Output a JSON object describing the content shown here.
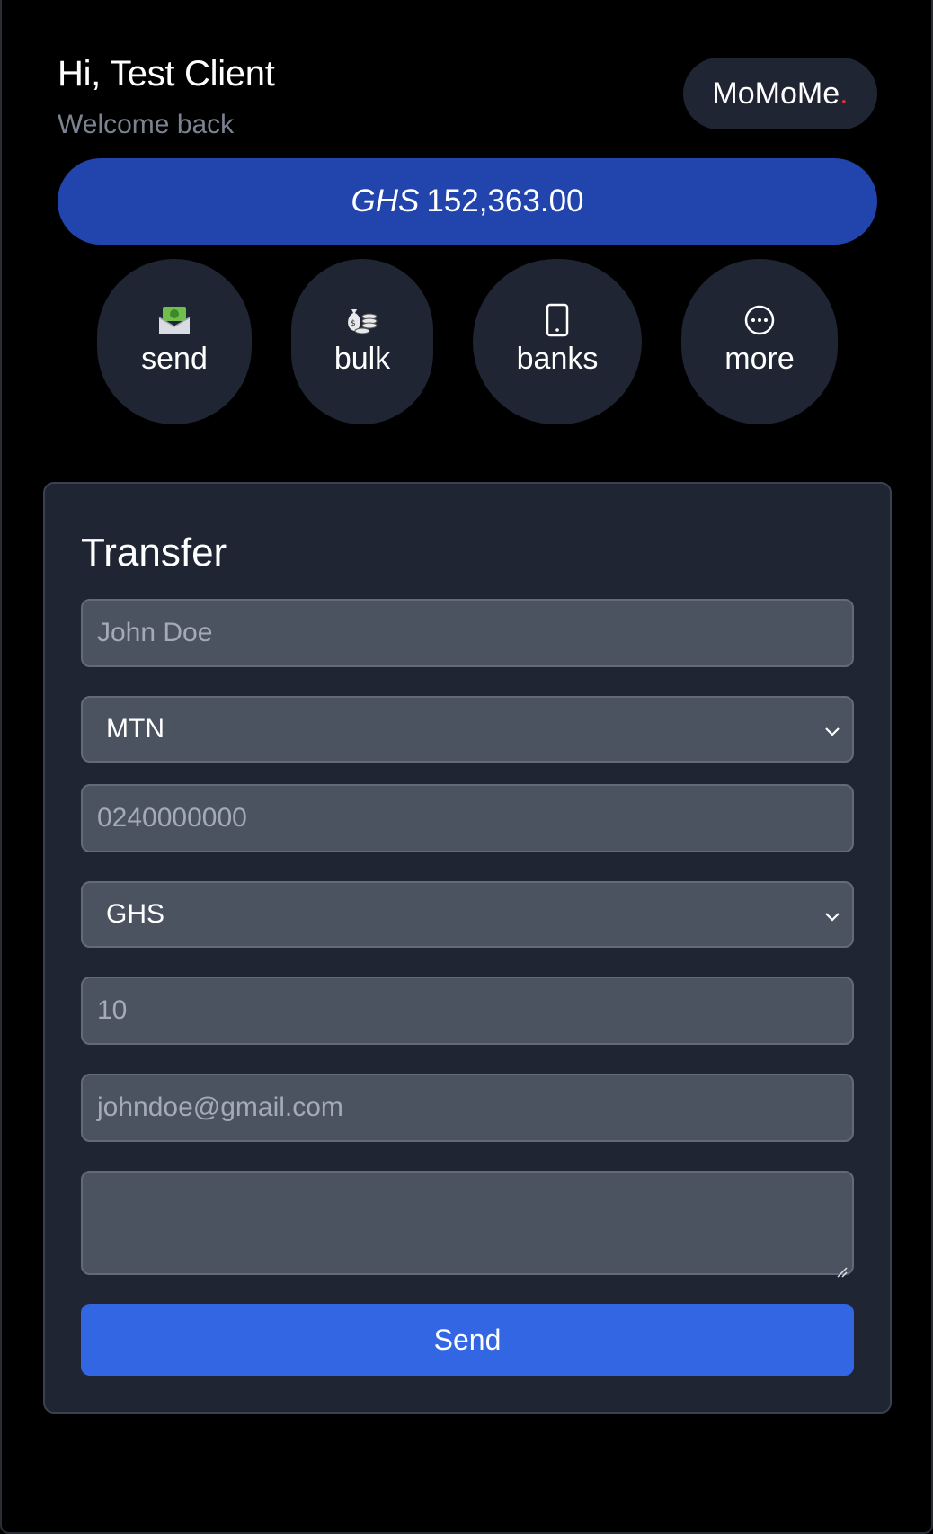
{
  "header": {
    "greeting": "Hi, Test Client",
    "subtitle": "Welcome back",
    "brand": "MoMoMe",
    "brand_dot": "."
  },
  "balance": {
    "currency": "GHS",
    "amount": "152,363.00"
  },
  "actions": [
    {
      "label": "send",
      "icon": "money-envelope-icon"
    },
    {
      "label": "bulk",
      "icon": "money-bags-icon"
    },
    {
      "label": "banks",
      "icon": "mobile-phone-icon"
    },
    {
      "label": "more",
      "icon": "ellipsis-circle-icon"
    }
  ],
  "transfer": {
    "title": "Transfer",
    "name_placeholder": "John Doe",
    "network_selected": "MTN",
    "phone_placeholder": "0240000000",
    "currency_selected": "GHS",
    "amount_placeholder": "10",
    "email_placeholder": "johndoe@gmail.com",
    "note_value": "",
    "send_label": "Send"
  },
  "colors": {
    "accent": "#3266e3",
    "balance_bg": "#2244ad",
    "card_bg": "#1f2532",
    "brand_dot": "#e53935"
  }
}
